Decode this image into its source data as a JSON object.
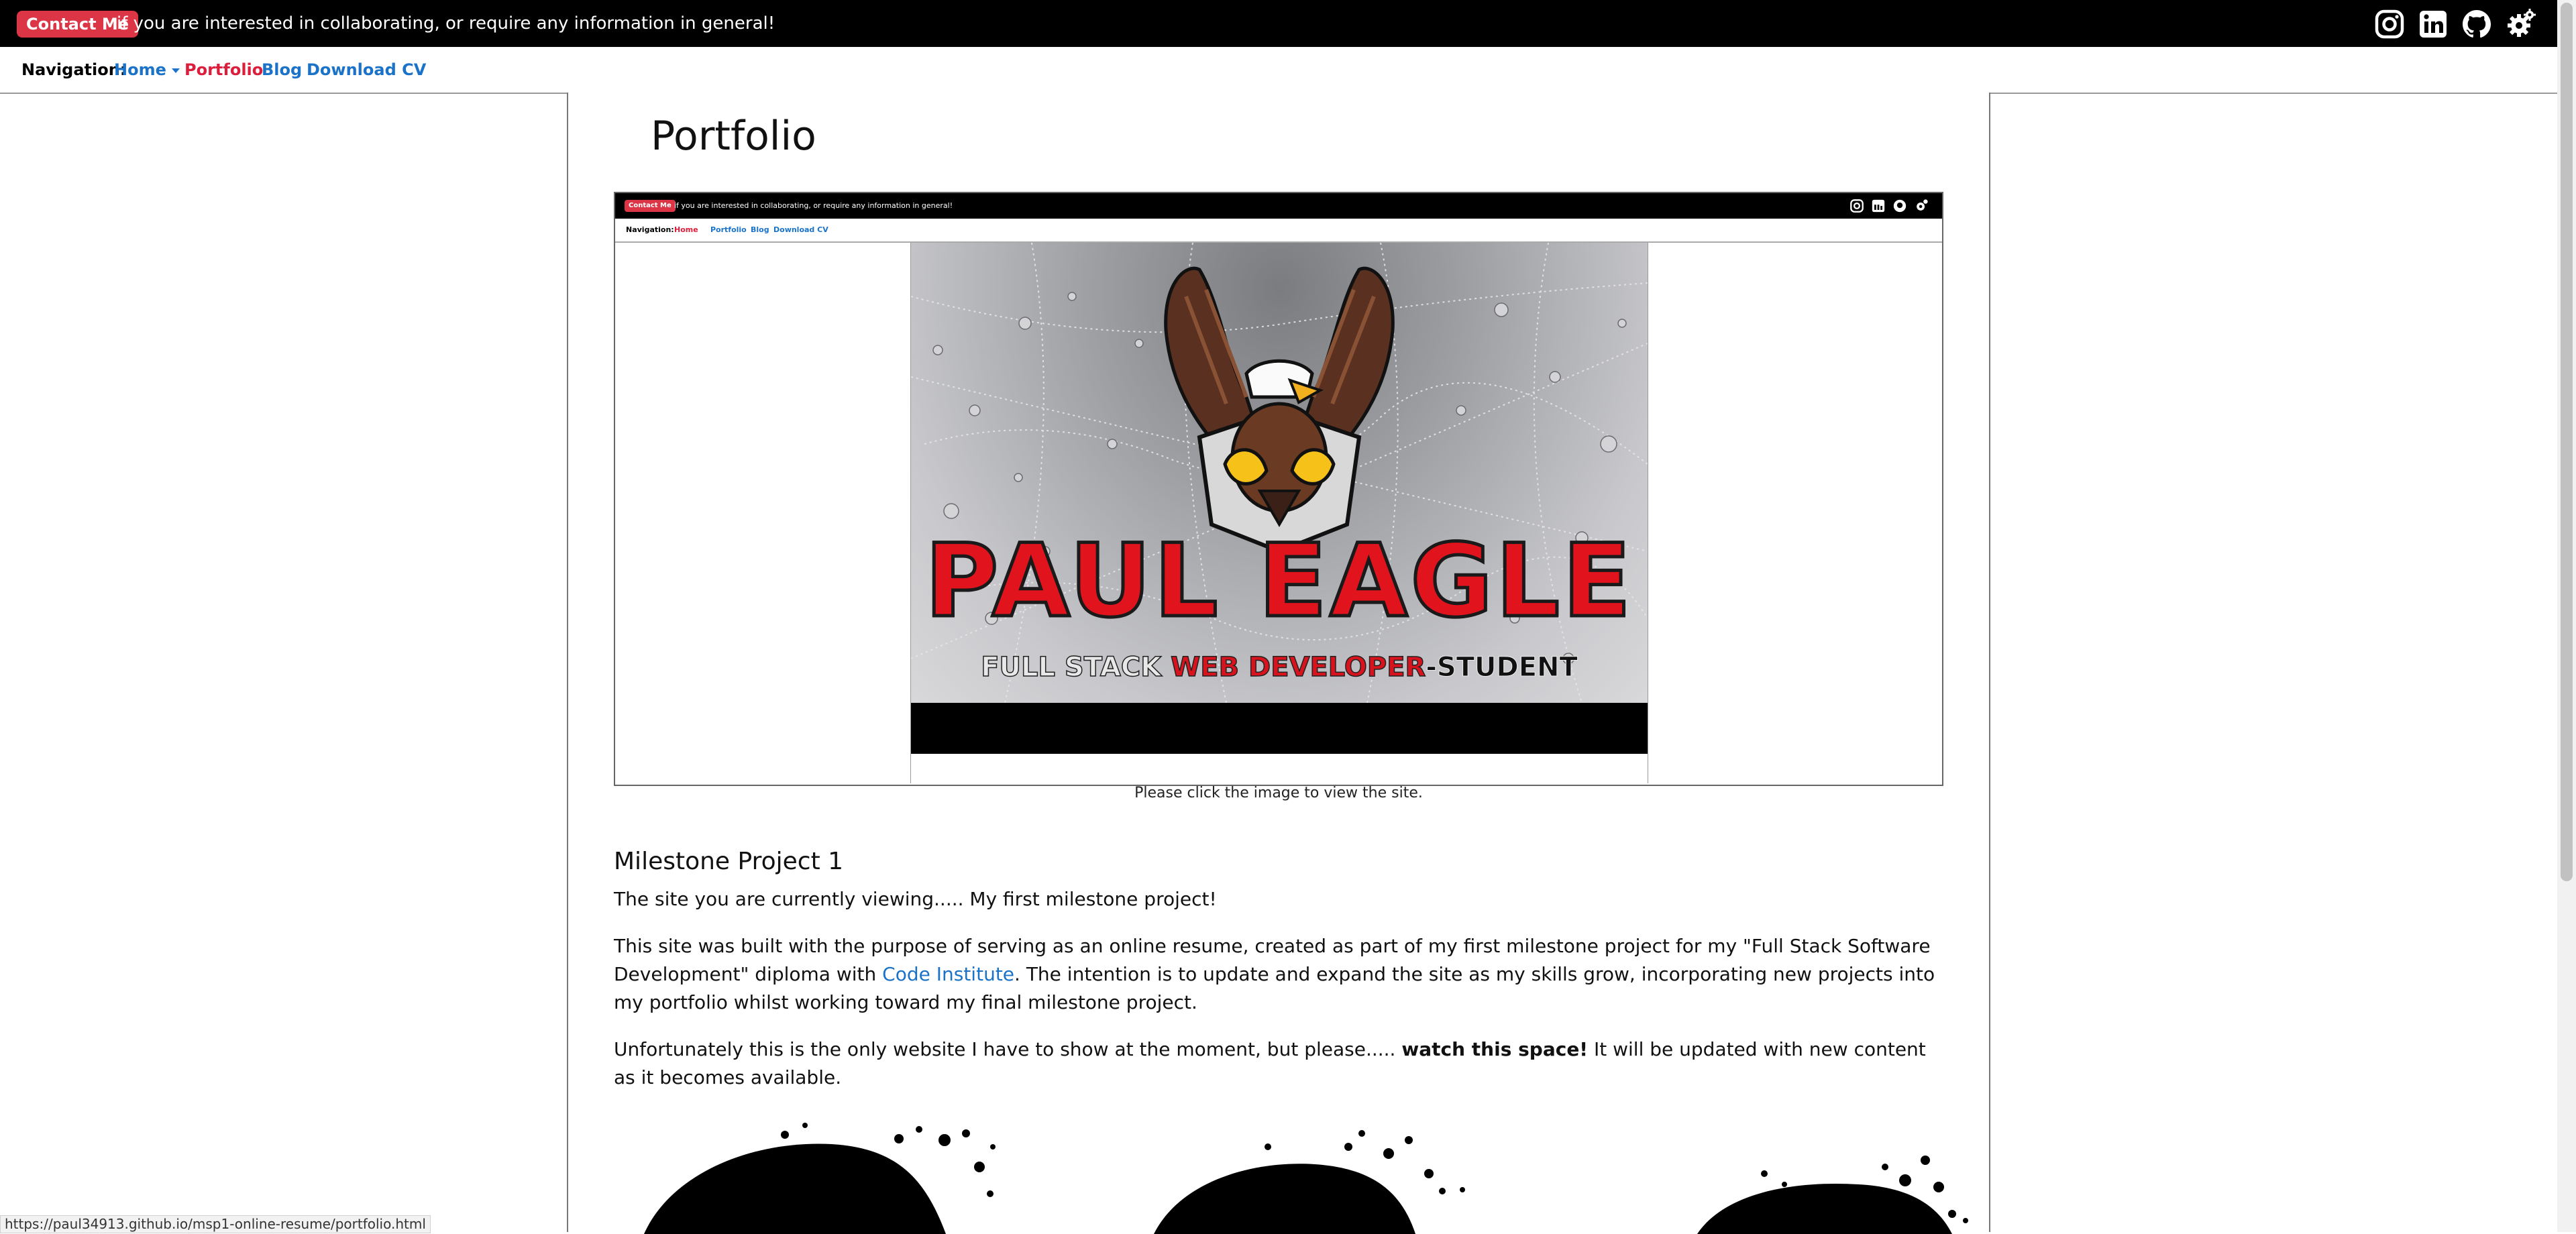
{
  "topbar": {
    "contact_label": "Contact Me",
    "contact_text": "if you are interested in collaborating, or require any information in general!",
    "social_icons": [
      "instagram-icon",
      "linkedin-icon",
      "github-icon",
      "gear-icon"
    ]
  },
  "nav": {
    "label": "Navigation:",
    "items": [
      {
        "label": "Home",
        "dropdown": true
      },
      {
        "label": "Portfolio",
        "active": true
      },
      {
        "label": "Blog"
      },
      {
        "label": "Download CV"
      }
    ]
  },
  "page": {
    "title": "Portfolio"
  },
  "preview": {
    "contact_label": "Contact Me",
    "contact_text": "if you are interested in collaborating, or require any information in general!",
    "nav_label": "Navigation:",
    "nav_items": [
      "Home",
      "Portfolio",
      "Blog",
      "Download CV"
    ],
    "logo_name": "PAUL EAGLE",
    "logo_sub_a": "FULL STACK ",
    "logo_sub_b": "WEB DEVELOPER",
    "logo_sub_c": "-STUDENT",
    "caption": "Please click the image to view the site."
  },
  "project": {
    "heading": "Milestone Project 1",
    "p1": "The site you are currently viewing..... My first milestone project!",
    "p2_before": "This site was built with the purpose of serving as an online resume, created as part of my first milestone project for my \"Full Stack Software Development\" diploma with ",
    "p2_link": "Code Institute",
    "p2_after": ". The intention is to update and expand the site as my skills grow, incorporating new projects into my portfolio whilst working toward my final milestone project.",
    "p3_before": "Unfortunately this is the only website I have to show at the moment, but please..... ",
    "p3_strong": "watch this space!",
    "p3_after": " It will be updated with new content as it becomes available."
  },
  "status_bar": {
    "url": "https://paul34913.github.io/msp1-online-resume/portfolio.html"
  },
  "colors": {
    "accent_red": "#dc3545",
    "link_blue": "#1a73c8",
    "active_red": "#dc1e3c"
  }
}
